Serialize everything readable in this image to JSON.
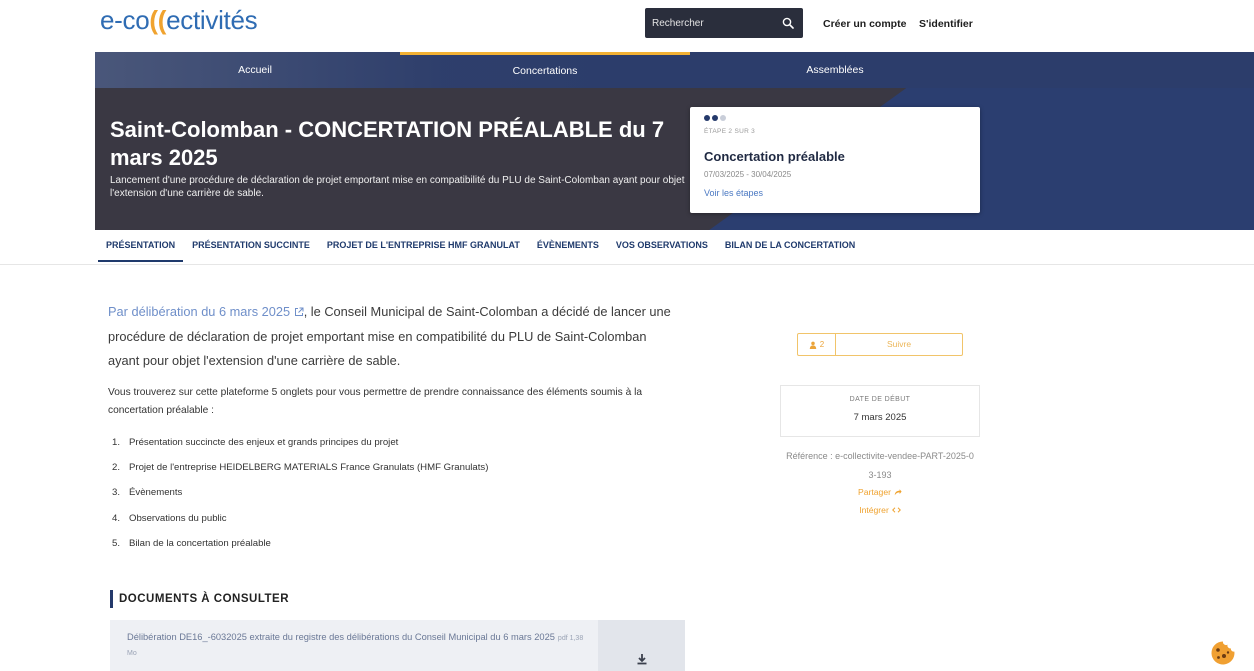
{
  "header": {
    "logo": {
      "part1": "e-co",
      "part2": "((",
      "part3": "ectivités"
    },
    "search": {
      "placeholder": "Rechercher",
      "icon": "search-icon"
    },
    "create_account": "Créer un compte",
    "login": "S'identifier"
  },
  "nav": {
    "items": [
      {
        "label": "Accueil",
        "active": false
      },
      {
        "label": "Concertations",
        "active": true
      },
      {
        "label": "Assemblées",
        "active": false
      }
    ]
  },
  "hero": {
    "title": "Saint-Colomban - CONCERTATION PRÉALABLE du 7 mars 2025",
    "subtitle": "Lancement d'une procédure de déclaration de projet emportant mise en compatibilité du PLU de Saint-Colomban ayant pour objet l'extension d'une carrière de sable.",
    "step": {
      "current": 2,
      "total": 3,
      "label": "ÉTAPE 2 SUR 3",
      "title": "Concertation préalable",
      "dates": "07/03/2025 - 30/04/2025",
      "link": "Voir les étapes"
    }
  },
  "tabs": [
    {
      "label": "PRÉSENTATION",
      "active": true
    },
    {
      "label": "PRÉSENTATION SUCCINTE",
      "active": false
    },
    {
      "label": "PROJET DE L'ENTREPRISE HMF GRANULAT",
      "active": false
    },
    {
      "label": "ÉVÈNEMENTS",
      "active": false
    },
    {
      "label": "VOS OBSERVATIONS",
      "active": false
    },
    {
      "label": "BILAN DE LA CONCERTATION",
      "active": false
    }
  ],
  "content": {
    "intro_link": "Par délibération du 6 mars 2025",
    "intro_text": ", le Conseil Municipal de Saint-Colomban a décidé de lancer une procédure de déclaration de projet emportant mise en compatibilité du PLU de Saint-Colomban ayant pour objet l'extension d'une carrière de sable.",
    "tabs_intro": "Vous trouverez sur cette plateforme 5 onglets pour vous permettre de prendre connaissance des éléments soumis à la concertation préalable :",
    "tabs_list": [
      "Présentation succincte des enjeux et grands principes du projet",
      "Projet de l'entreprise HEIDELBERG MATERIALS France Granulats (HMF Granulats)",
      "Évènements",
      "Observations du public",
      "Bilan de la concertation préalable"
    ],
    "documents_heading": "DOCUMENTS À CONSULTER",
    "documents": [
      {
        "title": "Délibération DE16_-6032025 extraite du registre des délibérations du Conseil Municipal du 6 mars 2025",
        "meta": "pdf 1,38 Mo"
      }
    ]
  },
  "sidebar": {
    "followers": "2",
    "follow_label": "Suivre",
    "start_date_label": "DATE DE DÉBUT",
    "start_date": "7 mars 2025",
    "reference": "Référence : e-collectivite-vendee-PART-2025-03-193",
    "share_label": "Partager",
    "embed_label": "Intégrer"
  },
  "colors": {
    "navy": "#24396b",
    "hero_dark": "#3a3843",
    "accent_orange": "#f0a32f",
    "link_blue": "#4a78c2",
    "tab_text": "#1f3a6c"
  },
  "icons": [
    "search-icon",
    "external-link-icon",
    "follower-icon",
    "share-icon",
    "embed-code-icon",
    "download-icon",
    "cookie-icon"
  ]
}
